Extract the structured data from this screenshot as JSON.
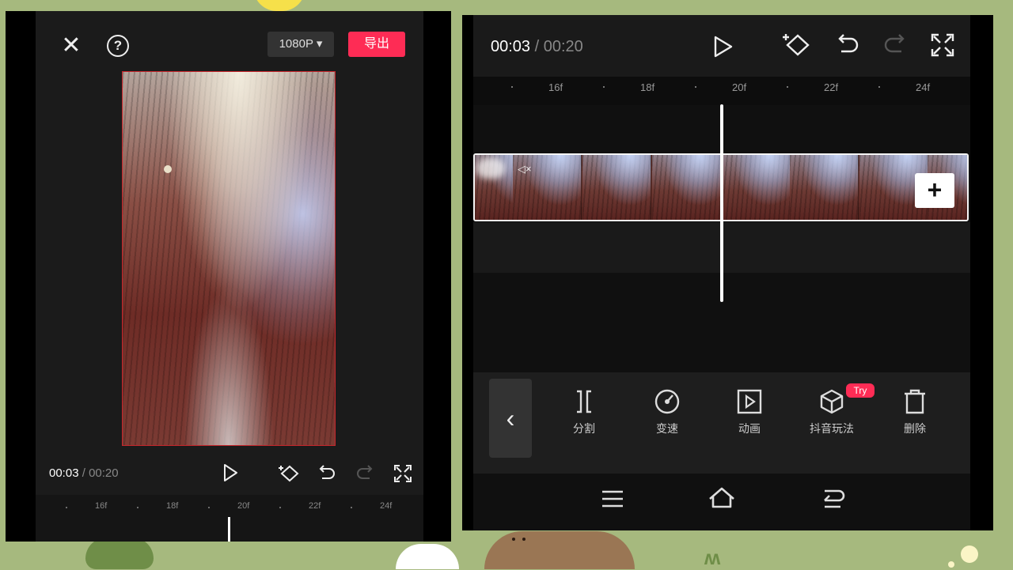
{
  "left_editor": {
    "resolution": "1080P",
    "export_label": "导出",
    "time_current": "00:03",
    "time_separator": " / ",
    "time_total": "00:20",
    "ruler_ticks": [
      "16f",
      "18f",
      "20f",
      "22f",
      "24f"
    ]
  },
  "right_editor": {
    "time_current": "00:03",
    "time_separator": " / ",
    "time_total": "00:20",
    "ruler_ticks": [
      "16f",
      "18f",
      "20f",
      "22f",
      "24f"
    ],
    "toolbar": {
      "split": "分割",
      "speed": "变速",
      "animation": "动画",
      "effects": "抖音玩法",
      "effects_badge": "Try",
      "delete": "删除"
    }
  },
  "colors": {
    "accent": "#fe2c55",
    "background": "#a6b97e",
    "panel": "#1b1b1b"
  }
}
